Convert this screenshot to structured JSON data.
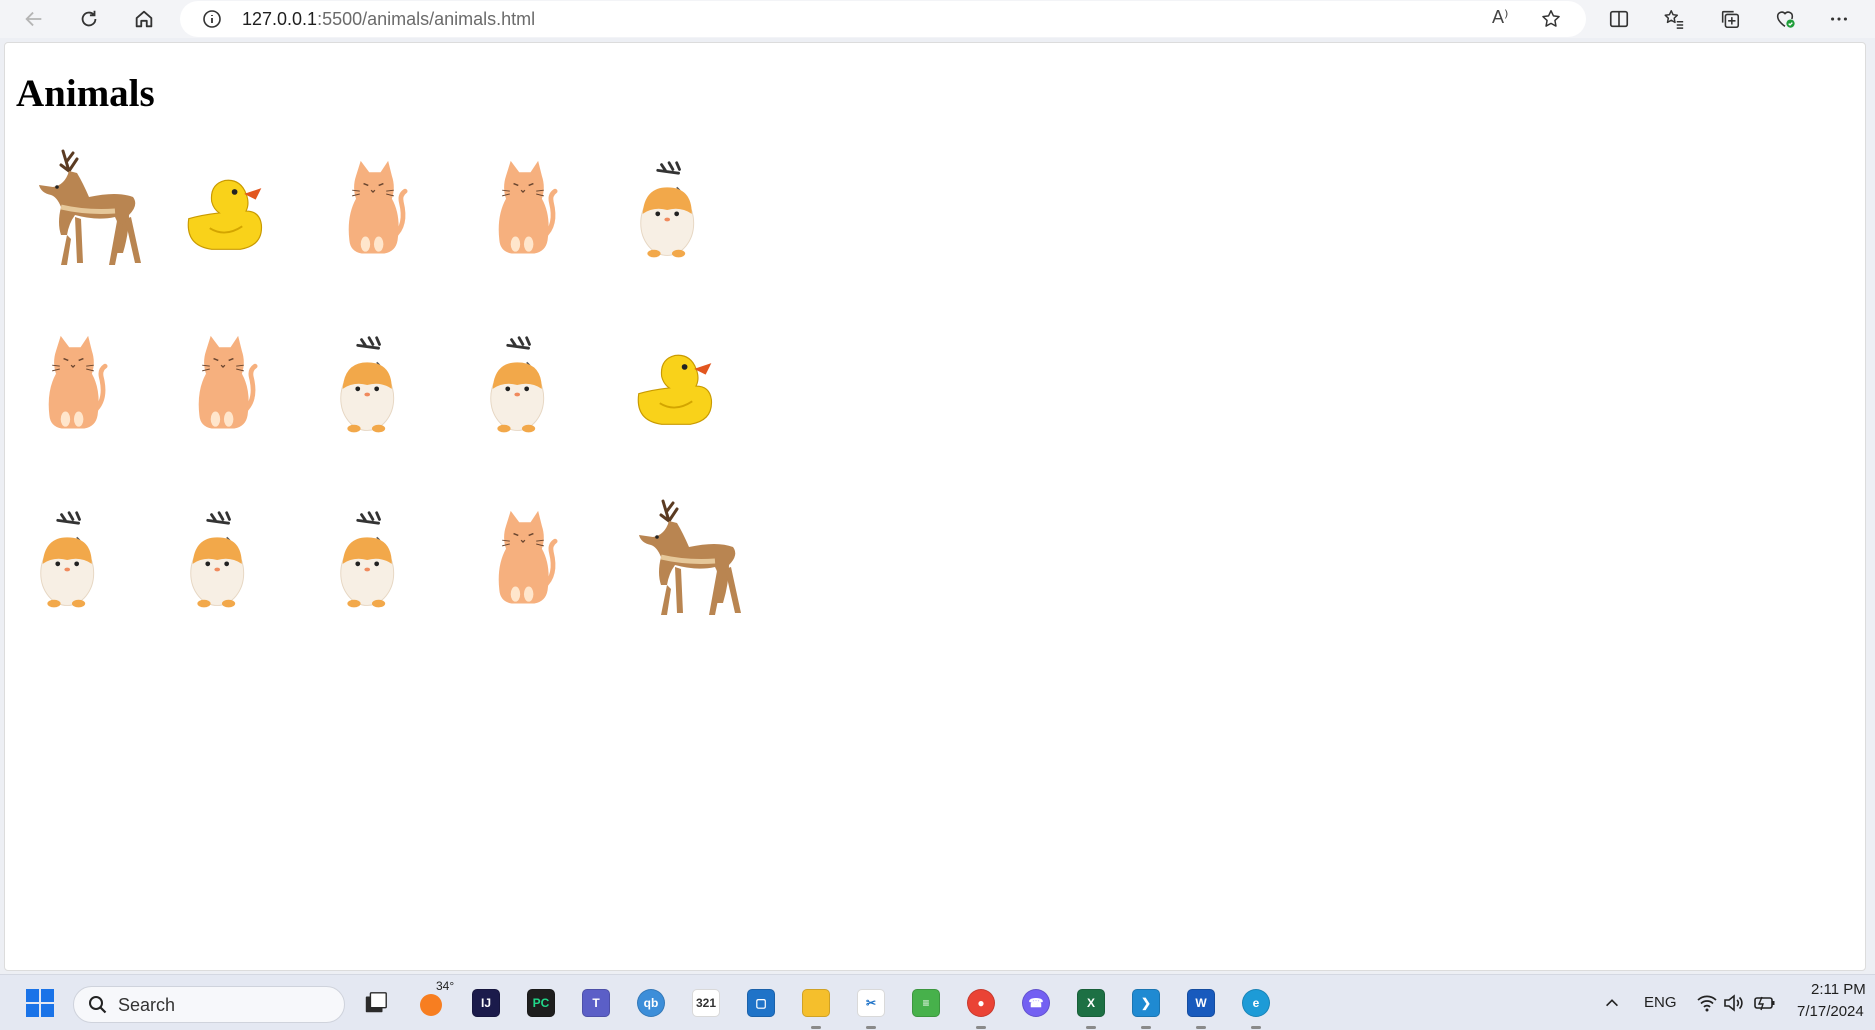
{
  "browser": {
    "url_host": "127.0.0.1",
    "url_path": ":5500/animals/animals.html",
    "read_aloud_label": "A⁾"
  },
  "page": {
    "title": "Animals",
    "grid": [
      [
        "deer",
        "duck",
        "cat",
        "cat",
        "hamster"
      ],
      [
        "cat",
        "cat",
        "hamster",
        "hamster",
        "duck"
      ],
      [
        "hamster",
        "hamster",
        "hamster",
        "cat",
        "deer"
      ]
    ]
  },
  "taskbar": {
    "search_placeholder": "Search",
    "weather_temp": "34°",
    "language": "ENG",
    "time": "2:11 PM",
    "date": "7/17/2024"
  },
  "colors": {
    "cat_body": "#f6b07e",
    "duck_body": "#f9d21a",
    "deer_body": "#b98551",
    "hamster_body": "#f7efe4",
    "hamster_head": "#f2a84a"
  }
}
